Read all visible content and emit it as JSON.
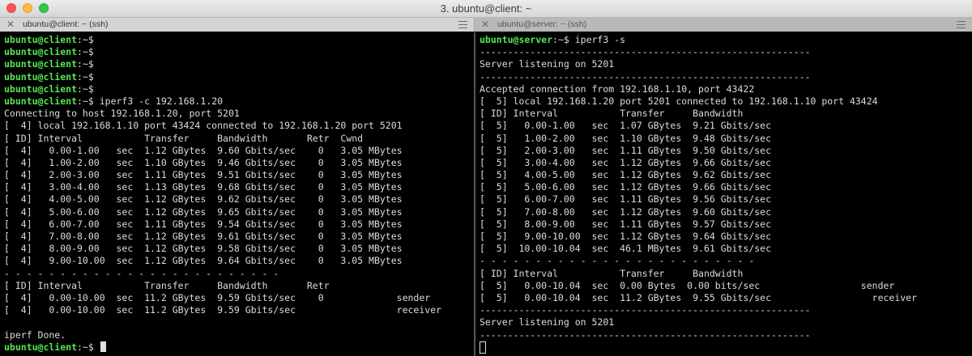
{
  "window": {
    "title": "3. ubuntu@client: ~"
  },
  "tabs": [
    {
      "label": "ubuntu@client: ~ (ssh)"
    },
    {
      "label": "ubuntu@server: ~ (ssh)"
    }
  ],
  "colors": {
    "prompt": "#55e655",
    "text": "#dcdcdc",
    "background": "#000000"
  },
  "icons": {
    "close": "close-icon",
    "menu": "hamburger-menu-icon"
  },
  "client": {
    "prompt_user": "ubuntu@client",
    "prompt_path": ":~$",
    "lines": [
      {
        "type": "prompt",
        "cmd": ""
      },
      {
        "type": "prompt",
        "cmd": ""
      },
      {
        "type": "prompt",
        "cmd": ""
      },
      {
        "type": "prompt",
        "cmd": ""
      },
      {
        "type": "prompt",
        "cmd": ""
      },
      {
        "type": "prompt",
        "cmd": " iperf3 -c 192.168.1.20"
      },
      {
        "type": "text",
        "text": "Connecting to host 192.168.1.20, port 5201"
      },
      {
        "type": "text",
        "text": "[  4] local 192.168.1.10 port 43424 connected to 192.168.1.20 port 5201"
      },
      {
        "type": "text",
        "text": "[ ID] Interval           Transfer     Bandwidth       Retr  Cwnd"
      },
      {
        "type": "text",
        "text": "[  4]   0.00-1.00   sec  1.12 GBytes  9.60 Gbits/sec    0   3.05 MBytes"
      },
      {
        "type": "text",
        "text": "[  4]   1.00-2.00   sec  1.10 GBytes  9.46 Gbits/sec    0   3.05 MBytes"
      },
      {
        "type": "text",
        "text": "[  4]   2.00-3.00   sec  1.11 GBytes  9.51 Gbits/sec    0   3.05 MBytes"
      },
      {
        "type": "text",
        "text": "[  4]   3.00-4.00   sec  1.13 GBytes  9.68 Gbits/sec    0   3.05 MBytes"
      },
      {
        "type": "text",
        "text": "[  4]   4.00-5.00   sec  1.12 GBytes  9.62 Gbits/sec    0   3.05 MBytes"
      },
      {
        "type": "text",
        "text": "[  4]   5.00-6.00   sec  1.12 GBytes  9.65 Gbits/sec    0   3.05 MBytes"
      },
      {
        "type": "text",
        "text": "[  4]   6.00-7.00   sec  1.11 GBytes  9.54 Gbits/sec    0   3.05 MBytes"
      },
      {
        "type": "text",
        "text": "[  4]   7.00-8.00   sec  1.12 GBytes  9.61 Gbits/sec    0   3.05 MBytes"
      },
      {
        "type": "text",
        "text": "[  4]   8.00-9.00   sec  1.12 GBytes  9.58 Gbits/sec    0   3.05 MBytes"
      },
      {
        "type": "text",
        "text": "[  4]   9.00-10.00  sec  1.12 GBytes  9.64 Gbits/sec    0   3.05 MBytes"
      },
      {
        "type": "text",
        "text": "- - - - - - - - - - - - - - - - - - - - - - - - -"
      },
      {
        "type": "text",
        "text": "[ ID] Interval           Transfer     Bandwidth       Retr"
      },
      {
        "type": "text",
        "text": "[  4]   0.00-10.00  sec  11.2 GBytes  9.59 Gbits/sec    0             sender"
      },
      {
        "type": "text",
        "text": "[  4]   0.00-10.00  sec  11.2 GBytes  9.59 Gbits/sec                  receiver"
      },
      {
        "type": "text",
        "text": ""
      },
      {
        "type": "text",
        "text": "iperf Done."
      },
      {
        "type": "prompt",
        "cmd": " ",
        "cursor": "block"
      }
    ]
  },
  "server": {
    "prompt_user": "ubuntu@server",
    "prompt_path": ":~$",
    "lines": [
      {
        "type": "prompt",
        "cmd": " iperf3 -s"
      },
      {
        "type": "text",
        "text": "-----------------------------------------------------------"
      },
      {
        "type": "text",
        "text": "Server listening on 5201"
      },
      {
        "type": "text",
        "text": "-----------------------------------------------------------"
      },
      {
        "type": "text",
        "text": "Accepted connection from 192.168.1.10, port 43422"
      },
      {
        "type": "text",
        "text": "[  5] local 192.168.1.20 port 5201 connected to 192.168.1.10 port 43424"
      },
      {
        "type": "text",
        "text": "[ ID] Interval           Transfer     Bandwidth"
      },
      {
        "type": "text",
        "text": "[  5]   0.00-1.00   sec  1.07 GBytes  9.21 Gbits/sec"
      },
      {
        "type": "text",
        "text": "[  5]   1.00-2.00   sec  1.10 GBytes  9.48 Gbits/sec"
      },
      {
        "type": "text",
        "text": "[  5]   2.00-3.00   sec  1.11 GBytes  9.50 Gbits/sec"
      },
      {
        "type": "text",
        "text": "[  5]   3.00-4.00   sec  1.12 GBytes  9.66 Gbits/sec"
      },
      {
        "type": "text",
        "text": "[  5]   4.00-5.00   sec  1.12 GBytes  9.62 Gbits/sec"
      },
      {
        "type": "text",
        "text": "[  5]   5.00-6.00   sec  1.12 GBytes  9.66 Gbits/sec"
      },
      {
        "type": "text",
        "text": "[  5]   6.00-7.00   sec  1.11 GBytes  9.56 Gbits/sec"
      },
      {
        "type": "text",
        "text": "[  5]   7.00-8.00   sec  1.12 GBytes  9.60 Gbits/sec"
      },
      {
        "type": "text",
        "text": "[  5]   8.00-9.00   sec  1.11 GBytes  9.57 Gbits/sec"
      },
      {
        "type": "text",
        "text": "[  5]   9.00-10.00  sec  1.12 GBytes  9.64 Gbits/sec"
      },
      {
        "type": "text",
        "text": "[  5]  10.00-10.04  sec  46.1 MBytes  9.61 Gbits/sec"
      },
      {
        "type": "text",
        "text": "- - - - - - - - - - - - - - - - - - - - - - - - -"
      },
      {
        "type": "text",
        "text": "[ ID] Interval           Transfer     Bandwidth"
      },
      {
        "type": "text",
        "text": "[  5]   0.00-10.04  sec  0.00 Bytes  0.00 bits/sec                  sender"
      },
      {
        "type": "text",
        "text": "[  5]   0.00-10.04  sec  11.2 GBytes  9.55 Gbits/sec                  receiver"
      },
      {
        "type": "text",
        "text": "-----------------------------------------------------------"
      },
      {
        "type": "text",
        "text": "Server listening on 5201"
      },
      {
        "type": "text",
        "text": "-----------------------------------------------------------"
      },
      {
        "type": "cursor",
        "cursor": "outline"
      }
    ]
  }
}
